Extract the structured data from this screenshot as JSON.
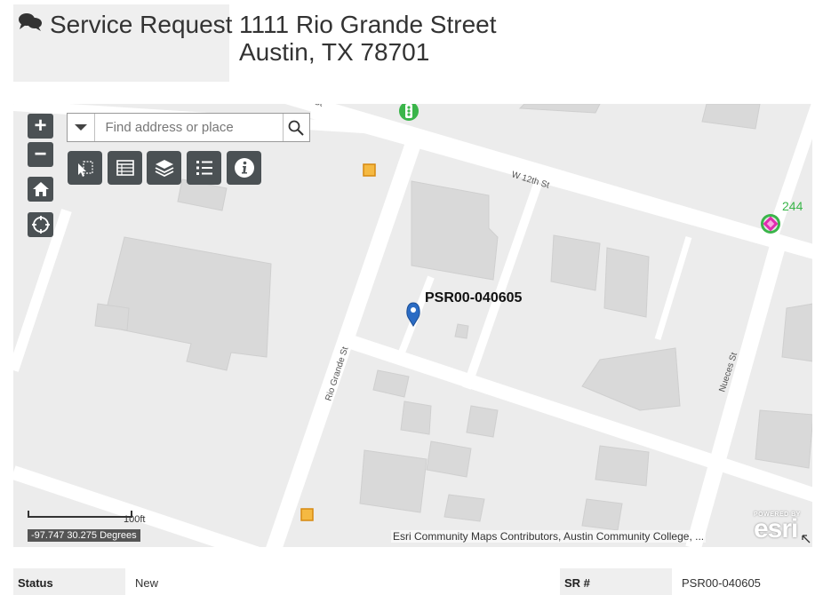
{
  "header": {
    "title": "Service Request",
    "icon": "comments-icon",
    "address_line1": "1111 Rio Grande Street",
    "address_line2": "Austin, TX 78701"
  },
  "map": {
    "search_placeholder": "Find address or place",
    "zoom_in": "+",
    "zoom_out": "−",
    "tools": [
      "select-icon",
      "table-icon",
      "layers-icon",
      "legend-icon",
      "info-icon"
    ],
    "streets": [
      "W 12th St",
      "Rio Grande St",
      "Nueces St"
    ],
    "pin_label": "PSR00-040605",
    "route_number": "244",
    "scale_label": "100ft",
    "coordinates": "-97.747 30.275 Degrees",
    "attribution": "Esri Community Maps Contributors, Austin Community College, ...",
    "esri_powered_by": "POWERED BY",
    "esri_brand": "esri",
    "colors": {
      "control": "#4b5154",
      "pin": "#2b6cc4",
      "marker": "#f5b942",
      "route": "#3ab54a"
    }
  },
  "details": {
    "status_label": "Status",
    "status_value": "New",
    "sr_label": "SR #",
    "sr_value": "PSR00-040605"
  }
}
